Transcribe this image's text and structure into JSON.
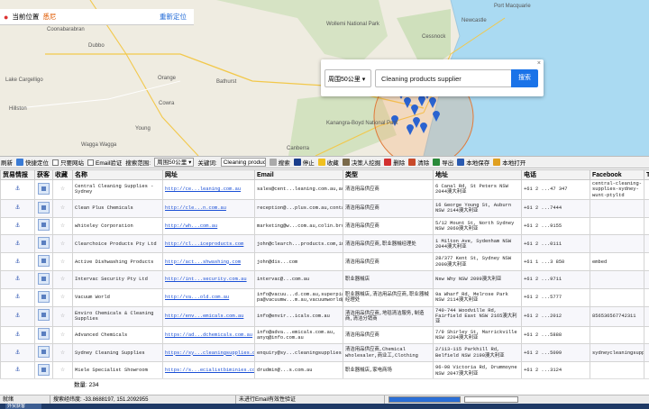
{
  "location_bar": {
    "label": "当前位置",
    "city": "悉尼",
    "refresh": "重新定位"
  },
  "map_labels": [
    {
      "text": "Coonabarabran"
    },
    {
      "text": "Wollemi National Park"
    },
    {
      "text": "Port Macquarie"
    },
    {
      "text": "Newcastle"
    },
    {
      "text": "Dubbo"
    },
    {
      "text": "Cessnock"
    },
    {
      "text": "Orange"
    },
    {
      "text": "Bathurst"
    },
    {
      "text": "Cowra"
    },
    {
      "text": "Young"
    },
    {
      "text": "Kanangra-Boyd National Park"
    },
    {
      "text": "Wagga Wagga"
    },
    {
      "text": "Canberra"
    },
    {
      "text": "Lake Cargelligo"
    },
    {
      "text": "Hillston"
    }
  ],
  "search_panel": {
    "radius": "周围50公里",
    "query": "Cleaning products supplier",
    "button": "搜索"
  },
  "toolbar": {
    "refresh": "刷新",
    "quick_locate": "快捷定位",
    "only_www": "只要网站",
    "email_verify": "Email验证",
    "scope_label": "搜索范围:",
    "scope_value": "周围50公里",
    "keyword_label": "关键词:",
    "keyword_value": "Cleaning product",
    "search": "搜索",
    "stop": "停止",
    "favorite": "收藏",
    "decision_maker": "决策人挖掘",
    "delete": "删除",
    "clear": "清除",
    "export": "导出",
    "save_local": "本地保存",
    "open_local": "本地打开"
  },
  "table": {
    "headers": [
      "贸易情报",
      "获客",
      "收藏",
      "名称",
      "网址",
      "Email",
      "类型",
      "地址",
      "电话",
      "Facebook",
      "T"
    ],
    "rows": [
      {
        "name": "Central Cleaning Supplies - Sydney",
        "url": "http://ce...leaning.com.au",
        "email": "sales@cent...leaning.com.au,accounts@centra...eaning.com.au,carlo",
        "type": "清洁用品供应商",
        "address": "6 Canal Rd, St Peters NSW 2044澳大利亚",
        "phone": "+61 2 ...47 347",
        "facebook": "central-cleaning-supplies-sydney-wunt-ptyltd"
      },
      {
        "name": "Clean Plus Chemicals",
        "url": "http://cle...n.com.au",
        "email": "reception@...plus.com.au,contact@cleanpl...m.au",
        "type": "清洁用品供应商",
        "address": "16 George Young St, Auburn NSW 2144澳大利亚",
        "phone": "+61 2 ...7444",
        "facebook": ""
      },
      {
        "name": "whiteley Corporation",
        "url": "http://wh...com.au",
        "email": "marketing@w...com.au,colin.brock@whit...",
        "type": "清洁用品供应商",
        "address": "5/12 Mount St, North Sydney NSW 2060澳大利亚",
        "phone": "+61 2 ...9155",
        "facebook": ""
      },
      {
        "name": "Clearchoice Products Pty Ltd",
        "url": "http://cl...iceproducts.com",
        "email": "john@clearch...products.com,info@clear...oducts.com,accounts",
        "type": "清洁用品供应商,职业器械经理处",
        "address": "1 Milton Ave, Sydenham NSW 2044澳大利亚",
        "phone": "+61 2 ...0111",
        "facebook": ""
      },
      {
        "name": "Active Dishwashing Products",
        "url": "http://act...shwashing.com",
        "email": "john@dis...com",
        "type": "清洁用品供应商",
        "address": "28/377 Kent St, Sydney NSW 2000澳大利亚",
        "phone": "+61 1 ...3 850",
        "facebook": "embed"
      },
      {
        "name": "Intervac Security Pty Ltd",
        "url": "http://int...security.com.au",
        "email": "intervac@...com.au",
        "type": "职业器械店",
        "address": "Nsw Why NSW 2099澳大利亚",
        "phone": "+61 2 ...9711",
        "facebook": ""
      },
      {
        "name": "Vacuum World",
        "url": "http://va...old.com.au",
        "email": "info@vacuu...d.com.au,superpia pa@vacuumw...m.au,vacuumworld@",
        "type": "职业器械店,清洁用品供应商,职业器械经理处",
        "address": "9a Wharf Rd, Melrose Park NSW 2114澳大利亚",
        "phone": "+61 2 ...5777",
        "facebook": ""
      },
      {
        "name": "Enviro Chemicals & Cleaning Supplies",
        "url": "http://env...emicals.com.au",
        "email": "info@envir...icals.com.au",
        "type": "清洁用品供应商,地毯清洁服务,制造商,清洁分销商",
        "address": "740-744 Woodville Rd, Fairfield East NSW 2165澳大利亚",
        "phone": "+61 2 ...2012",
        "facebook": "856536567742311"
      },
      {
        "name": "Advanced Chemicals",
        "url": "https://ad...dchemicals.com.au",
        "email": "info@adva...emicals.com.au, anyq@info.com.au",
        "type": "清洁用品供应商",
        "address": "7/9 Shirley St, Marrickville NSW 2204澳大利亚",
        "phone": "+61 2 ...5888",
        "facebook": ""
      },
      {
        "name": "Sydney Cleaning Supplies",
        "url": "https://sy...cleaningsupplies.com.au",
        "email": "enquiry@sy...cleaningsupplies.com.au,orders@syd...ningsupplies.com.au",
        "type": "清洁用品供应商,Chemical wholesaler,商业工,Clothing",
        "address": "2/113-115 Parkhill Rd, Belfield NSW 2190澳大利亚",
        "phone": "+61 2 ...5099",
        "facebook": "sydneycleaningsupplies.view_public_for"
      },
      {
        "name": "Miele Specialist Showroom",
        "url": "https://s...ecialistbiminies.com.au",
        "email": "drudmin@...s.com.au",
        "type": "职业器械店,家电商场",
        "address": "96-98 Victoria Rd, Drummoyne NSW 2047澳大利亚",
        "phone": "+61 2 ...3124",
        "facebook": ""
      }
    ]
  },
  "count_label": "数量: 234",
  "status": {
    "left": "就绪",
    "coords": "搜索经纬度: -33.8688197, 151.2092955",
    "email_note": "未进行Email有效性验证"
  },
  "taskbar_tab": "外贸获客"
}
